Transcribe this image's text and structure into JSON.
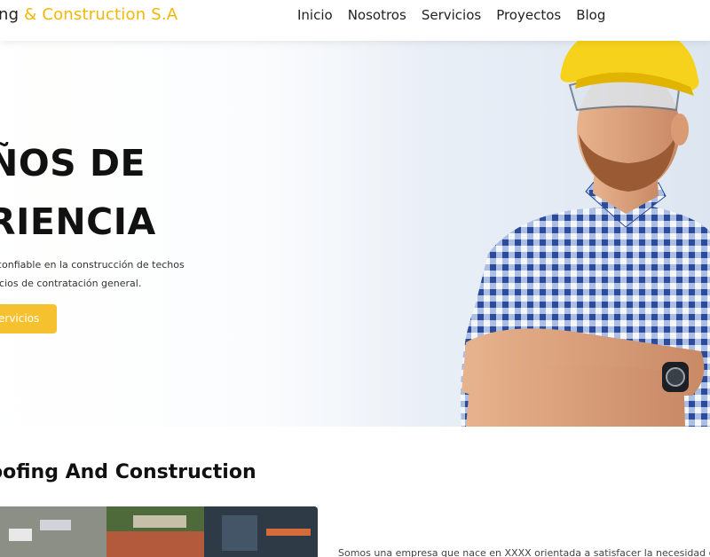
{
  "header": {
    "logo_part1": "ng",
    "logo_part2": " & Construction S.A",
    "nav": [
      "Inicio",
      "Nosotros",
      "Servicios",
      "Proyectos",
      "Blog"
    ]
  },
  "hero": {
    "heading_line1": "ÑOS DE",
    "heading_line2": "RIENCIA",
    "paragraph_line1": "confiable en la construcción de techos",
    "paragraph_line2": "icios de contratación general.",
    "button_label": "ervicios"
  },
  "section": {
    "title": "oofing And Construction",
    "about_text": "Somos una empresa que nace en XXXX orientada a satisfacer la necesidad d"
  },
  "colors": {
    "accent": "#f2b705",
    "button": "#f5c12e"
  }
}
